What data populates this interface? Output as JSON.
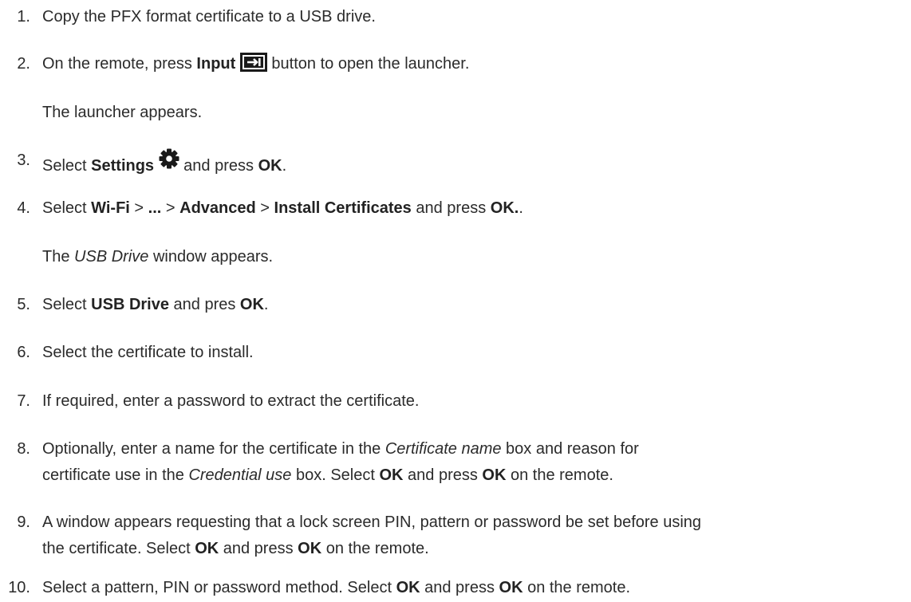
{
  "steps": [
    {
      "num": "1.",
      "a": "Copy the PFX format certificate to a USB drive."
    },
    {
      "num": "2.",
      "a": "On the remote, press ",
      "b1": "Input",
      "c": " button to open the launcher.",
      "note": "The launcher appears."
    },
    {
      "num": "3.",
      "a": "Select ",
      "b1": "Settings",
      "c": " and press ",
      "b2": "OK",
      "d": "."
    },
    {
      "num": "4.",
      "a": "Select ",
      "b1": "Wi-Fi",
      "c": " > ",
      "b2": "...",
      "d": " > ",
      "b3": "Advanced",
      "e": " > ",
      "b4": "Install Certificates",
      "f": " and press ",
      "b5": "OK.",
      "g": ".",
      "note_a": "The ",
      "note_i": "USB Drive",
      "note_b": " window appears."
    },
    {
      "num": "5.",
      "a": "Select ",
      "b1": "USB Drive",
      "c": " and pres ",
      "b2": "OK",
      "d": "."
    },
    {
      "num": "6.",
      "a": "Select the certificate to install."
    },
    {
      "num": "7.",
      "a": "If required, enter a password to extract the certificate."
    },
    {
      "num": "8.",
      "a": "Optionally, enter a name for the certificate in the ",
      "i1": "Certificate name",
      "b": " box and reason for",
      "line2_a": "certificate use in the ",
      "i2": "Credential use",
      "line2_b": " box. Select ",
      "b1": "OK",
      "line2_c": " and press ",
      "b2": "OK",
      "line2_d": " on the remote."
    },
    {
      "num": "9.",
      "a": "A window appears requesting that a lock screen PIN, pattern or password be set before using",
      "line2_a": "the certificate. Select ",
      "b1": "OK",
      "line2_b": " and press ",
      "b2": "OK",
      "line2_c": " on the remote."
    },
    {
      "num": "10.",
      "a": "Select a pattern, PIN or password method. Select ",
      "b1": "OK",
      "c": " and press ",
      "b2": "OK",
      "d": " on the remote."
    }
  ],
  "icons": {
    "input": "input-source-icon",
    "settings": "gear-icon"
  },
  "colors": {
    "text": "#2b2b2b",
    "icon": "#1a1a1a"
  }
}
